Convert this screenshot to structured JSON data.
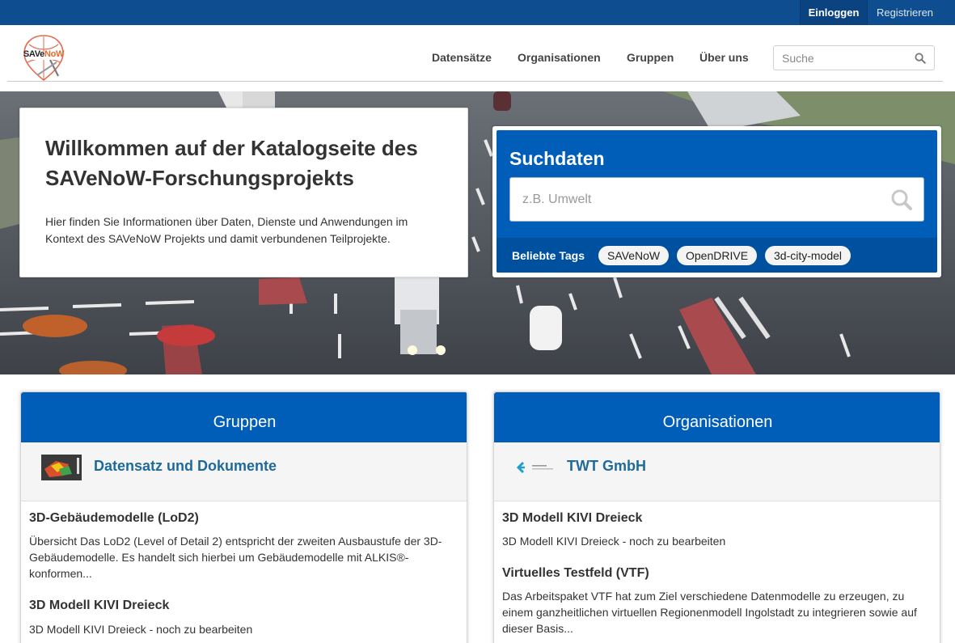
{
  "account": {
    "login": "Einloggen",
    "register": "Registrieren"
  },
  "logo": {
    "text": "SAVeNoW"
  },
  "nav": {
    "items": [
      "Datensätze",
      "Organisationen",
      "Gruppen",
      "Über uns"
    ],
    "search_placeholder": "Suche"
  },
  "welcome": {
    "title": "Willkommen auf der Katalogseite des SAVeNoW-Forschungsprojekts",
    "text": "Hier finden Sie Informationen über Daten, Dienste und Anwendungen im Kontext des SAVeNoW Projekts und damit verbundenen Teilprojekte."
  },
  "search": {
    "title": "Suchdaten",
    "placeholder": "z.B. Umwelt",
    "tags_label": "Beliebte Tags",
    "tags": [
      "SAVeNoW",
      "OpenDRIVE",
      "3d-city-model"
    ]
  },
  "groups": {
    "title": "Gruppen",
    "featured": "Datensatz und Dokumente",
    "items": [
      {
        "title": "3D-Gebäudemodelle (LoD2)",
        "desc": "Übersicht Das LoD2 (Level of Detail 2) entspricht der zweiten Ausbaustufe der 3D-Gebäudemodelle. Es handelt sich hierbei um Gebäudemodelle mit ALKIS®-konformen..."
      },
      {
        "title": "3D Modell KIVI Dreieck",
        "desc": "3D Modell KIVI Dreieck - noch zu bearbeiten"
      }
    ]
  },
  "organisations": {
    "title": "Organisationen",
    "featured": "TWT GmbH",
    "items": [
      {
        "title": "3D Modell KIVI Dreieck",
        "desc": "3D Modell KIVI Dreieck - noch zu bearbeiten"
      },
      {
        "title": "Virtuelles Testfeld (VTF)",
        "desc": "Das Arbeitspaket VTF hat zum Ziel verschiedene Datenmodelle zu erzeugen, zu einem ganzheitlichen virtuellen Regionenmodell Ingolstadt zu integrieren sowie auf dieser Basis..."
      }
    ]
  },
  "colors": {
    "topbar": "#0e4d8f",
    "accent": "#005eb8",
    "link": "#1f6a9a"
  }
}
